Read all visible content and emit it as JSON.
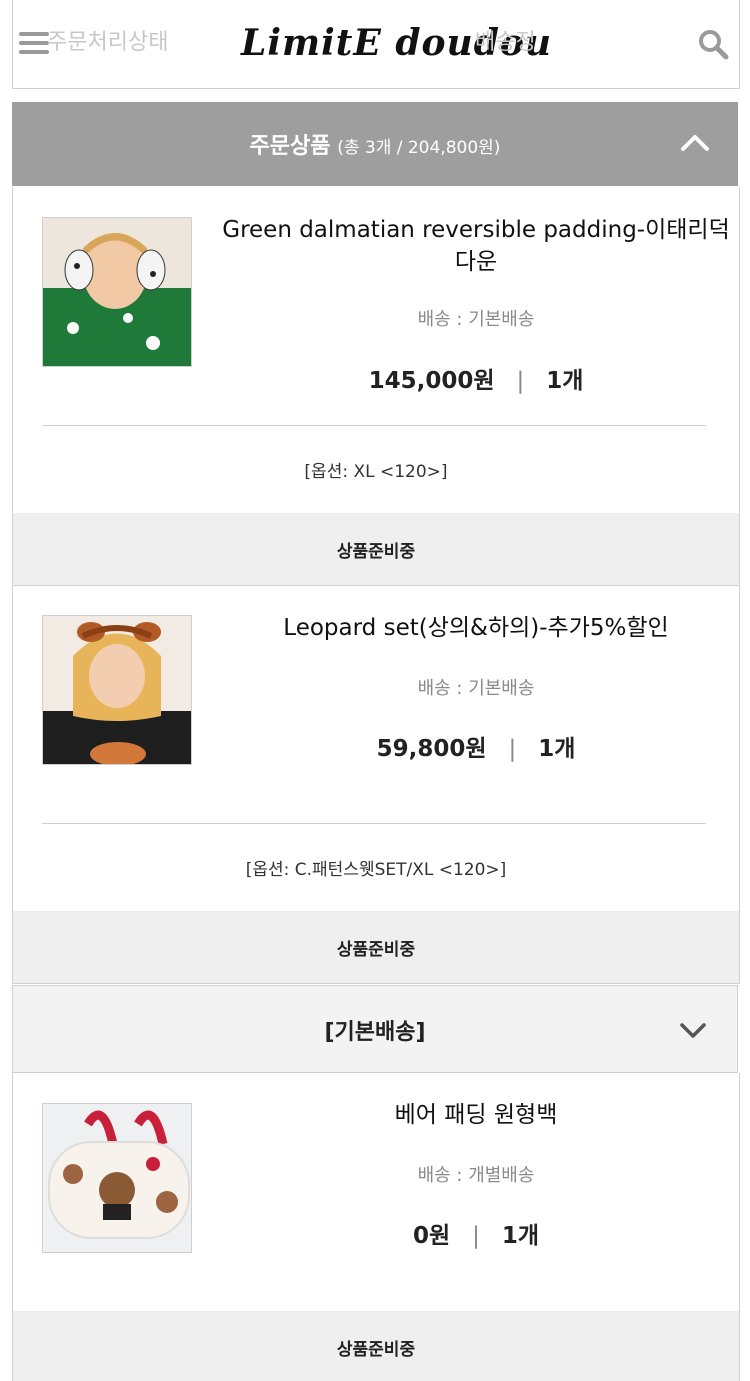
{
  "header": {
    "ghost_left": "주문처리상태",
    "logo": "LimitE doudou",
    "ghost_right": "배송정"
  },
  "section": {
    "title": "주문상품",
    "summary": "(총 3개 / 204,800원)"
  },
  "items": [
    {
      "name": "Green dalmatian reversible padding-이태리덕다운",
      "shipping": "배송 : 기본배송",
      "price": "145,000원",
      "qty": "1개",
      "option": "[옵션: XL <120>]",
      "status": "상품준비중"
    },
    {
      "name": "Leopard set(상의&하의)-추가5%할인",
      "shipping": "배송 : 기본배송",
      "price": "59,800원",
      "qty": "1개",
      "option": "[옵션: C.패턴스웻SET/XL <120>]",
      "status": "상품준비중"
    },
    {
      "name": "베어 패딩 원형백",
      "shipping": "배송 : 개별배송",
      "price": "0원",
      "qty": "1개",
      "status": "상품준비중"
    }
  ],
  "shipping_group": {
    "title": "[기본배송]"
  },
  "colors": {
    "header_bar": "#9e9e9e",
    "status_bg": "#efefef"
  },
  "icons": [
    "menu-icon",
    "search-icon",
    "chevron-up-icon",
    "chevron-down-icon"
  ]
}
